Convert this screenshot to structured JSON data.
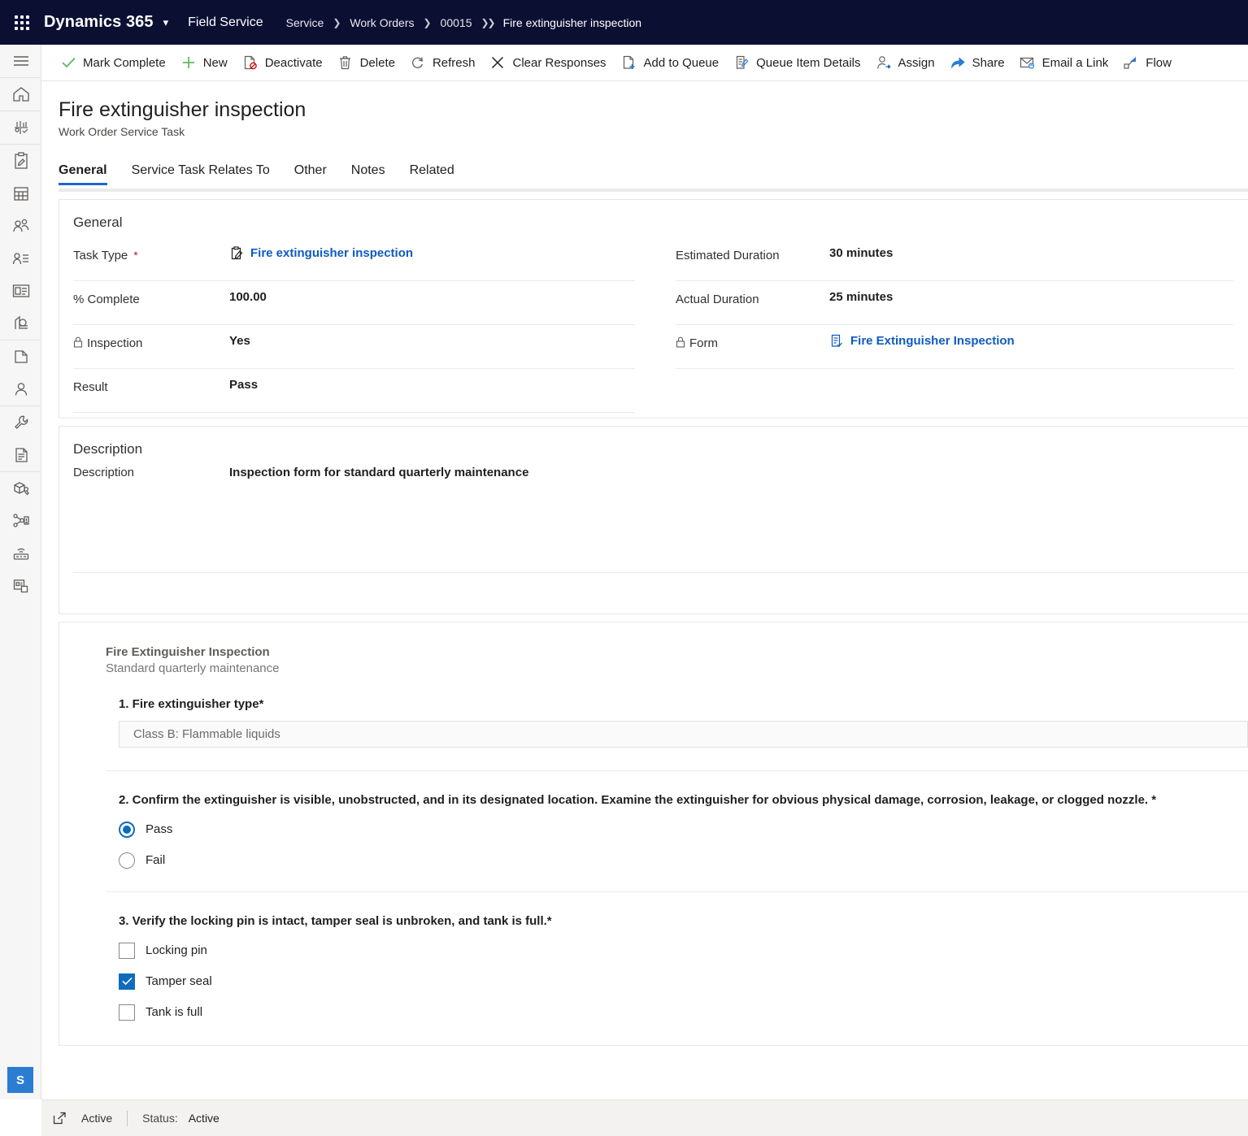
{
  "topbar": {
    "waffle_icon": "app-launcher-icon",
    "brand": "Dynamics 365",
    "brand_chevron_icon": "chevron-down-icon",
    "app_name": "Field Service",
    "breadcrumbs": [
      {
        "label": "Service"
      },
      {
        "label": "Work Orders"
      },
      {
        "label": "00015"
      },
      {
        "label": "Fire extinguisher inspection"
      }
    ],
    "bg_color": "#0b1033"
  },
  "rail": {
    "items": [
      {
        "name": "hamburger-menu-icon"
      },
      {
        "name": "home-icon"
      },
      {
        "name": "recent-icon"
      },
      {
        "name": "clipboard-edit-icon"
      },
      {
        "name": "calendar-icon"
      },
      {
        "name": "accounts-icon"
      },
      {
        "name": "contacts-icon"
      },
      {
        "name": "card-icon"
      },
      {
        "name": "service-account-icon"
      },
      {
        "name": "documents-icon"
      },
      {
        "name": "user-icon"
      },
      {
        "name": "wrench-icon"
      },
      {
        "name": "file-lines-icon"
      },
      {
        "name": "product-icon"
      },
      {
        "name": "connections-icon"
      },
      {
        "name": "iot-device-icon"
      },
      {
        "name": "dashboard-icon"
      }
    ],
    "badge_label": "S"
  },
  "commandbar": {
    "items": [
      {
        "label": "Mark Complete",
        "icon": "checkmark-icon"
      },
      {
        "label": "New",
        "icon": "plus-icon"
      },
      {
        "label": "Deactivate",
        "icon": "deactivate-icon"
      },
      {
        "label": "Delete",
        "icon": "trash-icon"
      },
      {
        "label": "Refresh",
        "icon": "refresh-icon"
      },
      {
        "label": "Clear Responses",
        "icon": "close-x-icon"
      },
      {
        "label": "Add to Queue",
        "icon": "add-to-queue-icon"
      },
      {
        "label": "Queue Item Details",
        "icon": "queue-item-details-icon"
      },
      {
        "label": "Assign",
        "icon": "assign-person-icon"
      },
      {
        "label": "Share",
        "icon": "share-icon"
      },
      {
        "label": "Email a Link",
        "icon": "email-link-icon"
      },
      {
        "label": "Flow",
        "icon": "flow-icon"
      }
    ]
  },
  "page": {
    "title": "Fire extinguisher inspection",
    "subtitle": "Work Order Service Task"
  },
  "tabs": [
    {
      "label": "General",
      "active": true
    },
    {
      "label": "Service Task Relates To",
      "active": false
    },
    {
      "label": "Other",
      "active": false
    },
    {
      "label": "Notes",
      "active": false
    },
    {
      "label": "Related",
      "active": false
    }
  ],
  "general": {
    "section_title": "General",
    "left_fields": [
      {
        "label": "Task Type",
        "required": "*",
        "value": "Fire extinguisher inspection",
        "link": true,
        "icon": "clipboard-pen-icon",
        "locked": false
      },
      {
        "label": "% Complete",
        "required": "",
        "value": "100.00",
        "link": false,
        "icon": "",
        "locked": false
      },
      {
        "label": "Inspection",
        "required": "",
        "value": "Yes",
        "link": false,
        "icon": "",
        "locked": true
      },
      {
        "label": "Result",
        "required": "",
        "value": "Pass",
        "link": false,
        "icon": "",
        "locked": false
      }
    ],
    "right_fields": [
      {
        "label": "Estimated Duration",
        "required": "",
        "value": "30 minutes",
        "link": false,
        "icon": "",
        "locked": false
      },
      {
        "label": "Actual Duration",
        "required": "",
        "value": "25 minutes",
        "link": false,
        "icon": "",
        "locked": false
      },
      {
        "label": "Form",
        "required": "",
        "value": "Fire Extinguisher Inspection",
        "link": true,
        "icon": "form-list-icon",
        "locked": true
      }
    ]
  },
  "description": {
    "section_title": "Description",
    "label": "Description",
    "value": "Inspection form for standard quarterly maintenance"
  },
  "inspection": {
    "title": "Fire Extinguisher Inspection",
    "subtitle": "Standard quarterly maintenance",
    "questions": [
      {
        "number": "1.",
        "text": "1. Fire extinguisher type*",
        "type": "text",
        "value": "Class B: Flammable liquids"
      },
      {
        "number": "2.",
        "text": "2. Confirm the extinguisher is visible, unobstructed, and in its designated location. Examine the extinguisher for obvious physical damage, corrosion, leakage, or clogged nozzle. *",
        "type": "radio",
        "options": [
          {
            "label": "Pass",
            "selected": true
          },
          {
            "label": "Fail",
            "selected": false
          }
        ]
      },
      {
        "number": "3.",
        "text": "3. Verify the locking pin is intact, tamper seal is unbroken, and tank is full.*",
        "type": "checkbox",
        "options": [
          {
            "label": "Locking pin",
            "selected": false
          },
          {
            "label": "Tamper seal",
            "selected": true
          },
          {
            "label": "Tank is full",
            "selected": false
          }
        ]
      }
    ]
  },
  "statusbar": {
    "popout_icon": "open-in-new-window-icon",
    "state": "Active",
    "status_key": "Status:",
    "status_value": "Active"
  },
  "colors": {
    "nav_bg": "#0b1033",
    "link": "#0f5bbf",
    "accent": "#0f6cbd",
    "tab_underline": "#2266cc",
    "required": "#a4262c",
    "checkmark_green": "#5cb85c",
    "badge_blue": "#2b7cd3"
  }
}
